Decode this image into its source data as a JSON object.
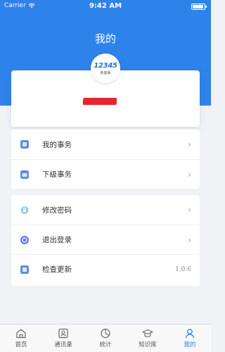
{
  "status_bar": {
    "carrier": "Carrier",
    "time": "9:42 AM"
  },
  "header": {
    "title": "我的",
    "color": "#2e83ea"
  },
  "profile": {
    "logo_number": "12345",
    "logo_subtitle": "新能版",
    "name_redacted": true
  },
  "menu": {
    "group_a": [
      {
        "label": "我的事务",
        "icon": "document-icon"
      },
      {
        "label": "下级事务",
        "icon": "folder-icon"
      }
    ],
    "group_b": [
      {
        "label": "修改密码",
        "icon": "lock-icon"
      },
      {
        "label": "退出登录",
        "icon": "logout-icon"
      },
      {
        "label": "检查更新",
        "icon": "update-icon",
        "value": "1.0.6"
      }
    ]
  },
  "tabbar": {
    "items": [
      {
        "label": "首页",
        "icon": "home-icon"
      },
      {
        "label": "通讯录",
        "icon": "contacts-icon"
      },
      {
        "label": "统计",
        "icon": "chart-pie-icon"
      },
      {
        "label": "知识库",
        "icon": "graduation-cap-icon"
      },
      {
        "label": "我的",
        "icon": "person-icon",
        "active": true
      }
    ],
    "active_color": "#2e83ea"
  }
}
